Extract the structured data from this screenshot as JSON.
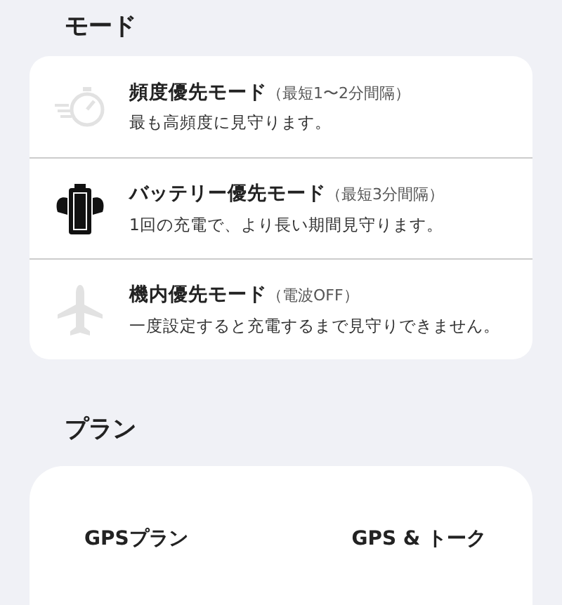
{
  "mode_section": {
    "heading": "モード",
    "modes": [
      {
        "kind": "stopwatch",
        "title": "頻度優先モード",
        "note": "（最短1〜2分間隔）",
        "description": "最も高頻度に見守ります。",
        "selected": false
      },
      {
        "kind": "battery",
        "title": "バッテリー優先モード",
        "note": "（最短3分間隔）",
        "description": "1回の充電で、より長い期間見守ります。",
        "selected": true
      },
      {
        "kind": "airplane",
        "title": "機内優先モード",
        "note": "（電波OFF）",
        "description": "一度設定すると充電するまで見守りできません。",
        "selected": false
      }
    ]
  },
  "plan_section": {
    "heading": "プラン",
    "plans": [
      {
        "label": "GPSプラン"
      },
      {
        "label": "GPS & トーク"
      }
    ]
  }
}
